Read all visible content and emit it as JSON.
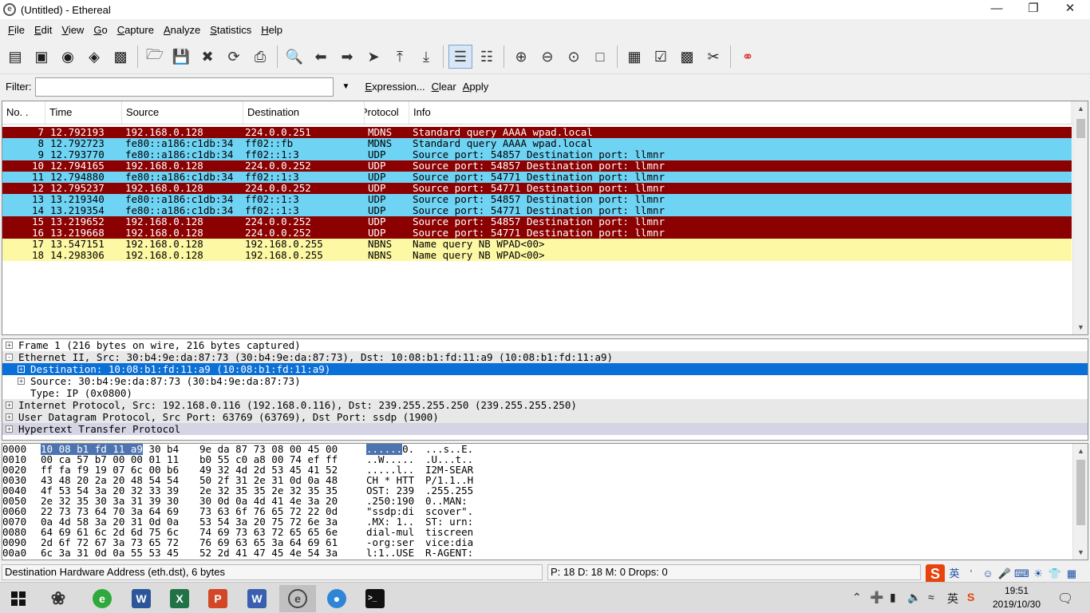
{
  "window": {
    "title": "(Untitled) - Ethereal",
    "app_icon": "ethereal-logo-icon",
    "controls": [
      "minimize-icon",
      "restore-icon",
      "close-icon"
    ]
  },
  "menu": [
    "File",
    "Edit",
    "View",
    "Go",
    "Capture",
    "Analyze",
    "Statistics",
    "Help"
  ],
  "toolbar": {
    "buttons": [
      "interface-list-icon",
      "capture-options-icon",
      "start-capture-icon",
      "stop-capture-icon",
      "restart-capture-icon",
      "open-icon",
      "save-icon",
      "close-file-icon",
      "reload-icon",
      "print-icon",
      "find-packet-icon",
      "go-back-icon",
      "go-forward-icon",
      "go-to-packet-icon",
      "go-first-icon",
      "go-last-icon",
      "colorize-icon",
      "autoscroll-icon",
      "zoom-in-icon",
      "zoom-out-icon",
      "zoom-normal-icon",
      "resize-columns-icon",
      "capture-filters-icon",
      "display-filters-icon",
      "coloring-rules-icon",
      "preferences-icon",
      "help-icon"
    ]
  },
  "filter": {
    "label": "Filter:",
    "value": "",
    "expression_label": "Expression...",
    "clear_label": "Clear",
    "apply_label": "Apply"
  },
  "packet_list": {
    "columns": [
      "No. .",
      "Time",
      "Source",
      "Destination",
      "Protocol",
      "Info"
    ],
    "rows": [
      {
        "no": "7",
        "time": "12.792193",
        "src": "192.168.0.128",
        "dst": "224.0.0.251",
        "proto": "MDNS",
        "info": "Standard query AAAA wpad.local",
        "color": "#8b0000",
        "fg": "#ffffff"
      },
      {
        "no": "8",
        "time": "12.792723",
        "src": "fe80::a186:c1db:34",
        "dst": "ff02::fb",
        "proto": "MDNS",
        "info": "Standard query AAAA wpad.local",
        "color": "#6fd3f4",
        "fg": "#000000"
      },
      {
        "no": "9",
        "time": "12.793770",
        "src": "fe80::a186:c1db:34",
        "dst": "ff02::1:3",
        "proto": "UDP",
        "info": "Source port: 54857  Destination port: llmnr",
        "color": "#6fd3f4",
        "fg": "#000000"
      },
      {
        "no": "10",
        "time": "12.794165",
        "src": "192.168.0.128",
        "dst": "224.0.0.252",
        "proto": "UDP",
        "info": "Source port: 54857  Destination port: llmnr",
        "color": "#8b0000",
        "fg": "#ffffff"
      },
      {
        "no": "11",
        "time": "12.794880",
        "src": "fe80::a186:c1db:34",
        "dst": "ff02::1:3",
        "proto": "UDP",
        "info": "Source port: 54771  Destination port: llmnr",
        "color": "#6fd3f4",
        "fg": "#000000"
      },
      {
        "no": "12",
        "time": "12.795237",
        "src": "192.168.0.128",
        "dst": "224.0.0.252",
        "proto": "UDP",
        "info": "Source port: 54771  Destination port: llmnr",
        "color": "#8b0000",
        "fg": "#ffffff"
      },
      {
        "no": "13",
        "time": "13.219340",
        "src": "fe80::a186:c1db:34",
        "dst": "ff02::1:3",
        "proto": "UDP",
        "info": "Source port: 54857  Destination port: llmnr",
        "color": "#6fd3f4",
        "fg": "#000000"
      },
      {
        "no": "14",
        "time": "13.219354",
        "src": "fe80::a186:c1db:34",
        "dst": "ff02::1:3",
        "proto": "UDP",
        "info": "Source port: 54771  Destination port: llmnr",
        "color": "#6fd3f4",
        "fg": "#000000"
      },
      {
        "no": "15",
        "time": "13.219652",
        "src": "192.168.0.128",
        "dst": "224.0.0.252",
        "proto": "UDP",
        "info": "Source port: 54857  Destination port: llmnr",
        "color": "#8b0000",
        "fg": "#ffffff"
      },
      {
        "no": "16",
        "time": "13.219668",
        "src": "192.168.0.128",
        "dst": "224.0.0.252",
        "proto": "UDP",
        "info": "Source port: 54771  Destination port: llmnr",
        "color": "#8b0000",
        "fg": "#ffffff"
      },
      {
        "no": "17",
        "time": "13.547151",
        "src": "192.168.0.128",
        "dst": "192.168.0.255",
        "proto": "NBNS",
        "info": "Name query NB WPAD<00>",
        "color": "#fdf8a3",
        "fg": "#000000"
      },
      {
        "no": "18",
        "time": "14.298306",
        "src": "192.168.0.128",
        "dst": "192.168.0.255",
        "proto": "NBNS",
        "info": "Name query NB WPAD<00>",
        "color": "#fdf8a3",
        "fg": "#000000"
      }
    ]
  },
  "details": [
    {
      "text": "Frame 1 (216 bytes on wire, 216 bytes captured)",
      "indent": 0,
      "expander": "+",
      "style": "plain"
    },
    {
      "text": "Ethernet II, Src: 30:b4:9e:da:87:73 (30:b4:9e:da:87:73), Dst: 10:08:b1:fd:11:a9 (10:08:b1:fd:11:a9)",
      "indent": 0,
      "expander": "-",
      "style": "shade"
    },
    {
      "text": "Destination: 10:08:b1:fd:11:a9 (10:08:b1:fd:11:a9)",
      "indent": 1,
      "expander": "+",
      "style": "sel"
    },
    {
      "text": "Source: 30:b4:9e:da:87:73 (30:b4:9e:da:87:73)",
      "indent": 1,
      "expander": "+",
      "style": "plain"
    },
    {
      "text": "Type: IP (0x0800)",
      "indent": 1,
      "expander": "",
      "style": "plain"
    },
    {
      "text": "Internet Protocol, Src: 192.168.0.116 (192.168.0.116), Dst: 239.255.255.250 (239.255.255.250)",
      "indent": 0,
      "expander": "+",
      "style": "shade"
    },
    {
      "text": "User Datagram Protocol, Src Port: 63769 (63769), Dst Port: ssdp (1900)",
      "indent": 0,
      "expander": "+",
      "style": "shade"
    },
    {
      "text": "Hypertext Transfer Protocol",
      "indent": 0,
      "expander": "+",
      "style": "last"
    }
  ],
  "bytes": [
    {
      "off": "0000",
      "hex_hl": "10 08 b1 fd 11 a9",
      "hex_a_rest": " 30 b4",
      "hex_b": "9e da 87 73 08 00 45 00",
      "asc_hl": "......",
      "asc_a_rest": "0.",
      "asc_b": "...s..E."
    },
    {
      "off": "0010",
      "hex_a": "00 ca 57 b7 00 00 01 11",
      "hex_b": "b0 55 c0 a8 00 74 ef ff",
      "asc_a": "..W.....",
      "asc_b": ".U...t.."
    },
    {
      "off": "0020",
      "hex_a": "ff fa f9 19 07 6c 00 b6",
      "hex_b": "49 32 4d 2d 53 45 41 52",
      "asc_a": ".....l..",
      "asc_b": "I2M-SEAR"
    },
    {
      "off": "0030",
      "hex_a": "43 48 20 2a 20 48 54 54",
      "hex_b": "50 2f 31 2e 31 0d 0a 48",
      "asc_a": "CH * HTT",
      "asc_b": "P/1.1..H"
    },
    {
      "off": "0040",
      "hex_a": "4f 53 54 3a 20 32 33 39",
      "hex_b": "2e 32 35 35 2e 32 35 35",
      "asc_a": "OST: 239",
      "asc_b": ".255.255"
    },
    {
      "off": "0050",
      "hex_a": "2e 32 35 30 3a 31 39 30",
      "hex_b": "30 0d 0a 4d 41 4e 3a 20",
      "asc_a": ".250:190",
      "asc_b": "0..MAN: "
    },
    {
      "off": "0060",
      "hex_a": "22 73 73 64 70 3a 64 69",
      "hex_b": "73 63 6f 76 65 72 22 0d",
      "asc_a": "\"ssdp:di",
      "asc_b": "scover\"."
    },
    {
      "off": "0070",
      "hex_a": "0a 4d 58 3a 20 31 0d 0a",
      "hex_b": "53 54 3a 20 75 72 6e 3a",
      "asc_a": ".MX: 1..",
      "asc_b": "ST: urn:"
    },
    {
      "off": "0080",
      "hex_a": "64 69 61 6c 2d 6d 75 6c",
      "hex_b": "74 69 73 63 72 65 65 6e",
      "asc_a": "dial-mul",
      "asc_b": "tiscreen"
    },
    {
      "off": "0090",
      "hex_a": "2d 6f 72 67 3a 73 65 72",
      "hex_b": "76 69 63 65 3a 64 69 61",
      "asc_a": "-org:ser",
      "asc_b": "vice:dia"
    },
    {
      "off": "00a0",
      "hex_a": "6c 3a 31 0d 0a 55 53 45",
      "hex_b": "52 2d 41 47 45 4e 54 3a",
      "asc_a": "l:1..USE",
      "asc_b": "R-AGENT:"
    }
  ],
  "status": {
    "field": "Destination Hardware Address (eth.dst), 6 bytes",
    "counts": "P: 18 D: 18 M: 0 Drops: 0"
  },
  "ime": {
    "logo": "S",
    "lang": "英",
    "icons": [
      "punctuation-icon",
      "emoji-icon",
      "microphone-icon",
      "keyboard-icon",
      "skin-icon",
      "toolbox-icon",
      "grid-menu-icon"
    ]
  },
  "taskbar": {
    "apps": [
      "windows-start-icon",
      "pinwheel-app-icon",
      "browser-360-icon",
      "word-icon",
      "excel-icon",
      "powerpoint-icon",
      "word-alt-icon",
      "ethereal-taskbar-icon",
      "earth-browser-icon",
      "terminal-icon"
    ],
    "tray_lang": "英",
    "time": "19:51",
    "date": "2019/10/30"
  },
  "colors": {
    "selection": "#0a6fd6",
    "byte_highlight": "#4d74b0"
  }
}
